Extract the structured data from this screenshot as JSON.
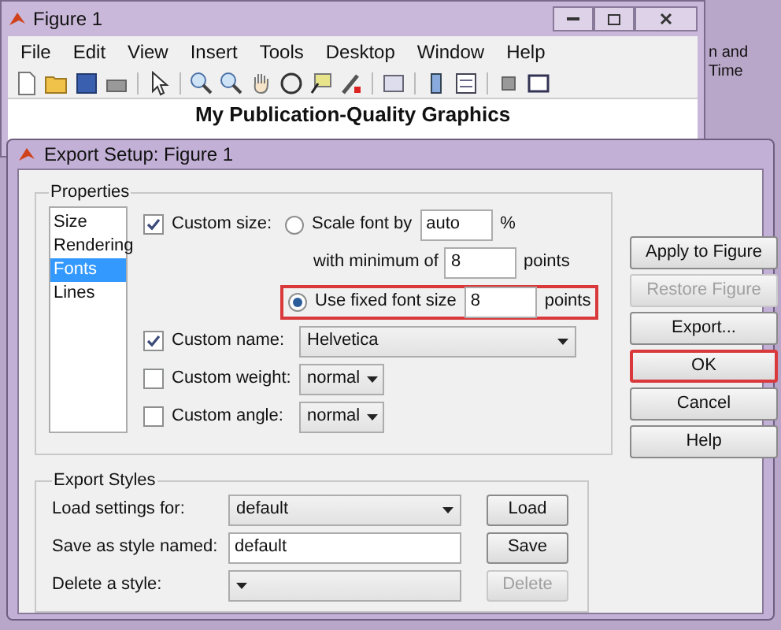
{
  "figure_window": {
    "title": "Figure 1",
    "menu": [
      "File",
      "Edit",
      "View",
      "Insert",
      "Tools",
      "Desktop",
      "Window",
      "Help"
    ],
    "plot_title": "My Publication-Quality Graphics"
  },
  "background": {
    "texts": [
      "n and",
      "Time"
    ]
  },
  "dialog": {
    "title": "Export Setup: Figure 1",
    "properties": {
      "title": "Properties",
      "items": [
        {
          "label": "Size",
          "selected": false
        },
        {
          "label": "Rendering",
          "selected": false
        },
        {
          "label": "Fonts",
          "selected": true
        },
        {
          "label": "Lines",
          "selected": false
        }
      ],
      "custom_size": {
        "label": "Custom size:",
        "checked": true
      },
      "scale_font": {
        "label": "Scale font by",
        "selected": false,
        "value": "auto",
        "unit": "%"
      },
      "minimum": {
        "label": "with minimum of",
        "value": "8",
        "unit": "points"
      },
      "fixed_size": {
        "label": "Use fixed font size",
        "selected": true,
        "value": "8",
        "unit": "points",
        "highlighted": true
      },
      "font_rows": [
        {
          "label": "Custom name:",
          "checked": true,
          "value": "Helvetica",
          "wide": true
        },
        {
          "label": "Custom weight:",
          "checked": false,
          "value": "normal",
          "wide": false
        },
        {
          "label": "Custom angle:",
          "checked": false,
          "value": "normal",
          "wide": false
        }
      ]
    },
    "buttons": [
      {
        "label": "Apply to Figure",
        "disabled": false,
        "highlighted": false
      },
      {
        "label": "Restore Figure",
        "disabled": true,
        "highlighted": false
      },
      {
        "label": "Export...",
        "disabled": false,
        "highlighted": false
      },
      {
        "label": "OK",
        "disabled": false,
        "highlighted": true
      },
      {
        "label": "Cancel",
        "disabled": false,
        "highlighted": false
      },
      {
        "label": "Help",
        "disabled": false,
        "highlighted": false
      }
    ],
    "export_styles": {
      "title": "Export Styles",
      "rows": [
        {
          "kind": "dropdown",
          "label": "Load settings for:",
          "value": "default",
          "button": "Load",
          "button_disabled": false
        },
        {
          "kind": "input",
          "label": "Save as style named:",
          "value": "default",
          "button": "Save",
          "button_disabled": false
        },
        {
          "kind": "dropdown",
          "label": "Delete a style:",
          "button": "Delete",
          "button_disabled": true
        }
      ]
    }
  }
}
